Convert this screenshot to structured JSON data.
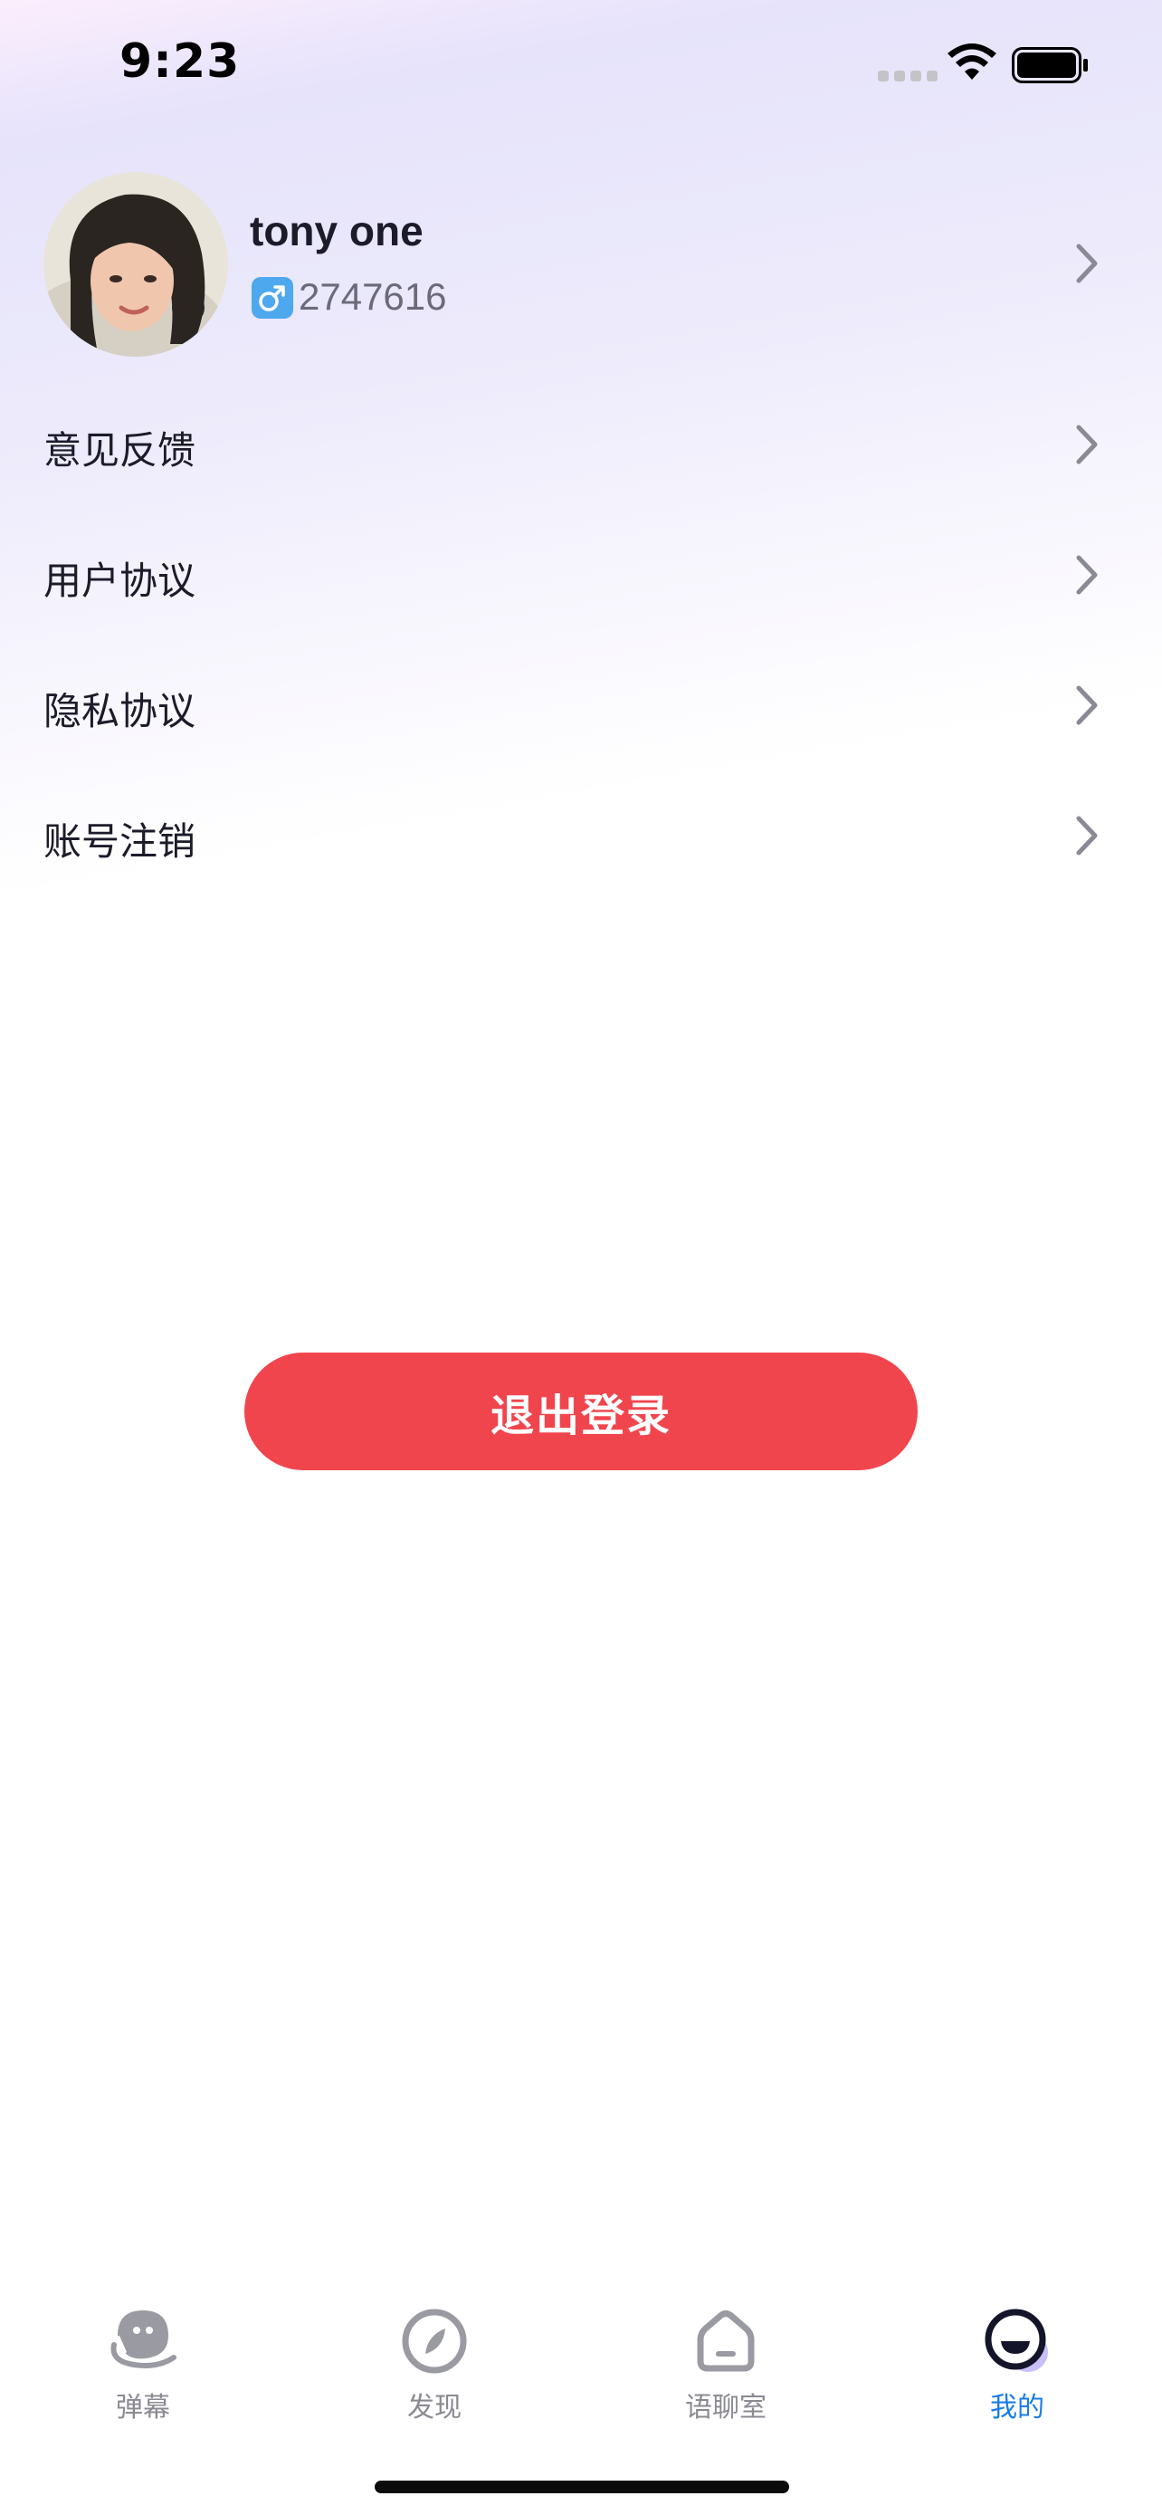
{
  "status_bar": {
    "time": "9:23"
  },
  "profile": {
    "name": "tony one",
    "gender_symbol": "♂",
    "id": "2747616"
  },
  "menu": {
    "items": [
      {
        "label": "意见反馈"
      },
      {
        "label": "用户协议"
      },
      {
        "label": "隐私协议"
      },
      {
        "label": "账号注销"
      }
    ]
  },
  "logout": {
    "label": "退出登录"
  },
  "tabs": [
    {
      "label": "弹幕",
      "icon": "face-bubble-icon",
      "active": false
    },
    {
      "label": "发现",
      "icon": "compass-icon",
      "active": false
    },
    {
      "label": "语聊室",
      "icon": "house-icon",
      "active": false
    },
    {
      "label": "我的",
      "icon": "profile-face-icon",
      "active": true
    }
  ],
  "colors": {
    "accent": "#1a7ce6",
    "logout": "#f1454e",
    "gender_badge": "#4da8ee"
  }
}
